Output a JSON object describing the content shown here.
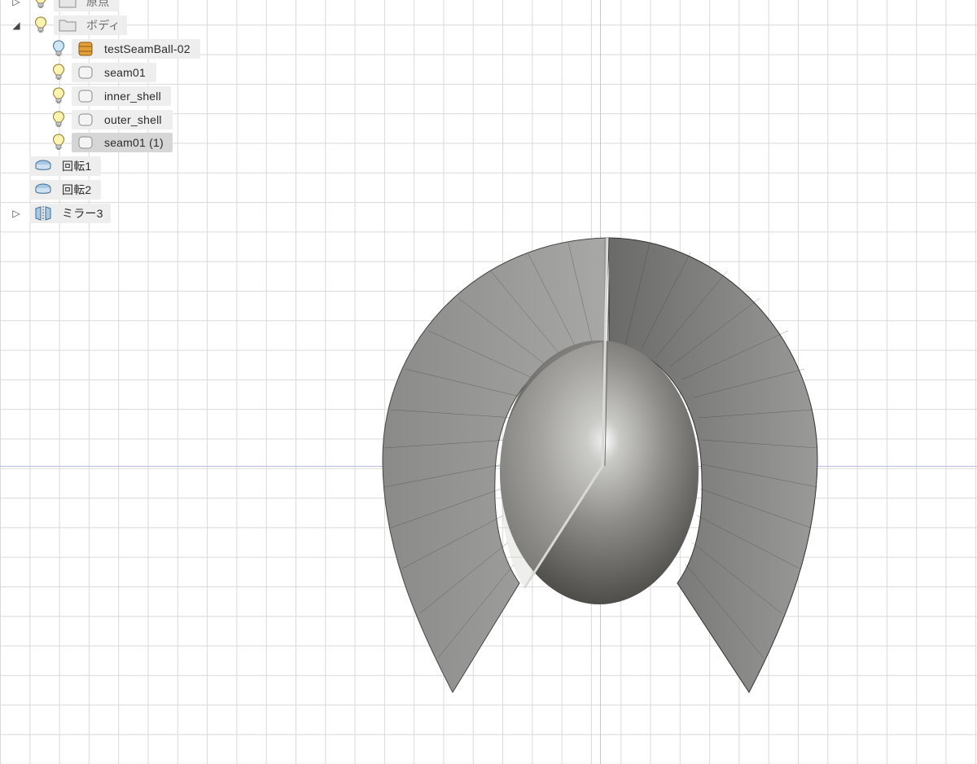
{
  "browser": {
    "items": [
      {
        "id": "origin",
        "label": "原点",
        "icon": "folder-icon"
      },
      {
        "id": "bodies",
        "label": "ボディ",
        "icon": "folder-icon"
      },
      {
        "id": "body-testSeamBall",
        "label": "testSeamBall-02",
        "icon": "component-body-icon"
      },
      {
        "id": "body-seam01",
        "label": "seam01",
        "icon": "body-icon"
      },
      {
        "id": "body-inner-shell",
        "label": "inner_shell",
        "icon": "body-icon"
      },
      {
        "id": "body-outer-shell",
        "label": "outer_shell",
        "icon": "body-icon"
      },
      {
        "id": "body-seam01-1",
        "label": "seam01 (1)",
        "icon": "body-icon",
        "selected": true
      },
      {
        "id": "revolve1",
        "label": "回転1",
        "icon": "revolve-feature-icon"
      },
      {
        "id": "revolve2",
        "label": "回転2",
        "icon": "revolve-feature-icon"
      },
      {
        "id": "mirror3",
        "label": "ミラー3",
        "icon": "mirror-feature-icon"
      }
    ]
  },
  "viewport": {
    "grid_color": "#d9d9d9",
    "axis_vertical_color": "#9ee39e",
    "axis_horizontal_color": "#b9b9e6",
    "model": "seam ball shells (rendered body)"
  }
}
